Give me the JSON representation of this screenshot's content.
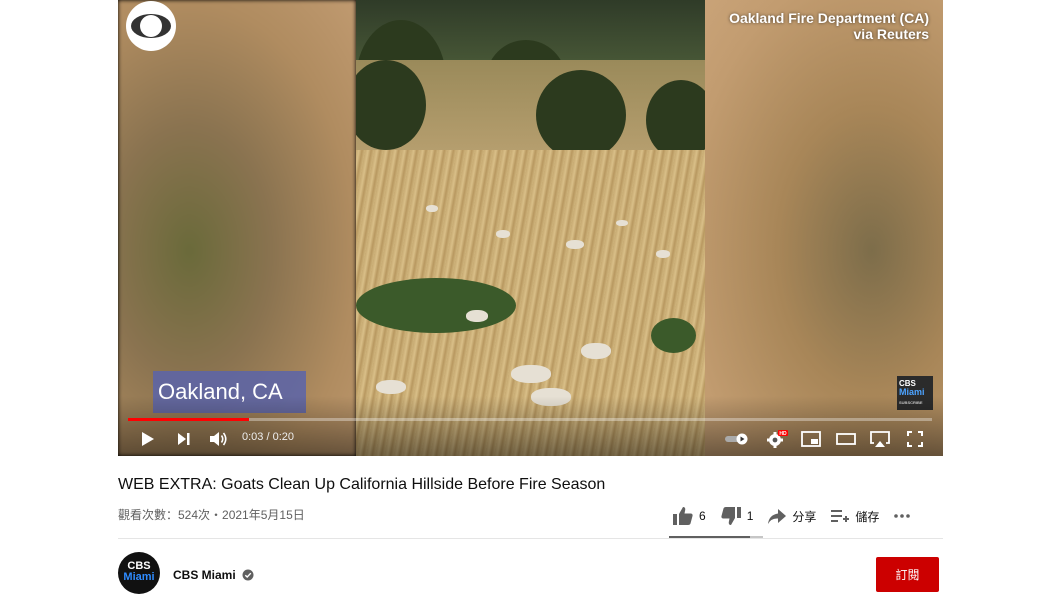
{
  "video": {
    "credit_line1": "Oakland Fire Department (CA)",
    "credit_line2": "via Reuters",
    "location_tag": "Oakland, CA",
    "watermark_line1": "CBS",
    "watermark_line2": "Miami",
    "watermark_line3": "SUBSCRIBE",
    "time_display": "0:03 / 0:20",
    "progress_fraction": 0.15,
    "hd_badge": "HD"
  },
  "info": {
    "title": "WEB EXTRA: Goats Clean Up California Hillside Before Fire Season",
    "meta": "觀看次數：524次・2021年5月15日",
    "likes": "6",
    "dislikes": "1",
    "share_label": "分享",
    "save_label": "儲存",
    "like_ratio": 0.857
  },
  "channel": {
    "name": "CBS Miami",
    "avatar_line1": "CBS",
    "avatar_line2": "Miami",
    "subscribe_label": "訂閱"
  },
  "colors": {
    "progress": "#ff0000",
    "subscribe": "#cc0000",
    "location_tag": "#5a64aa"
  }
}
